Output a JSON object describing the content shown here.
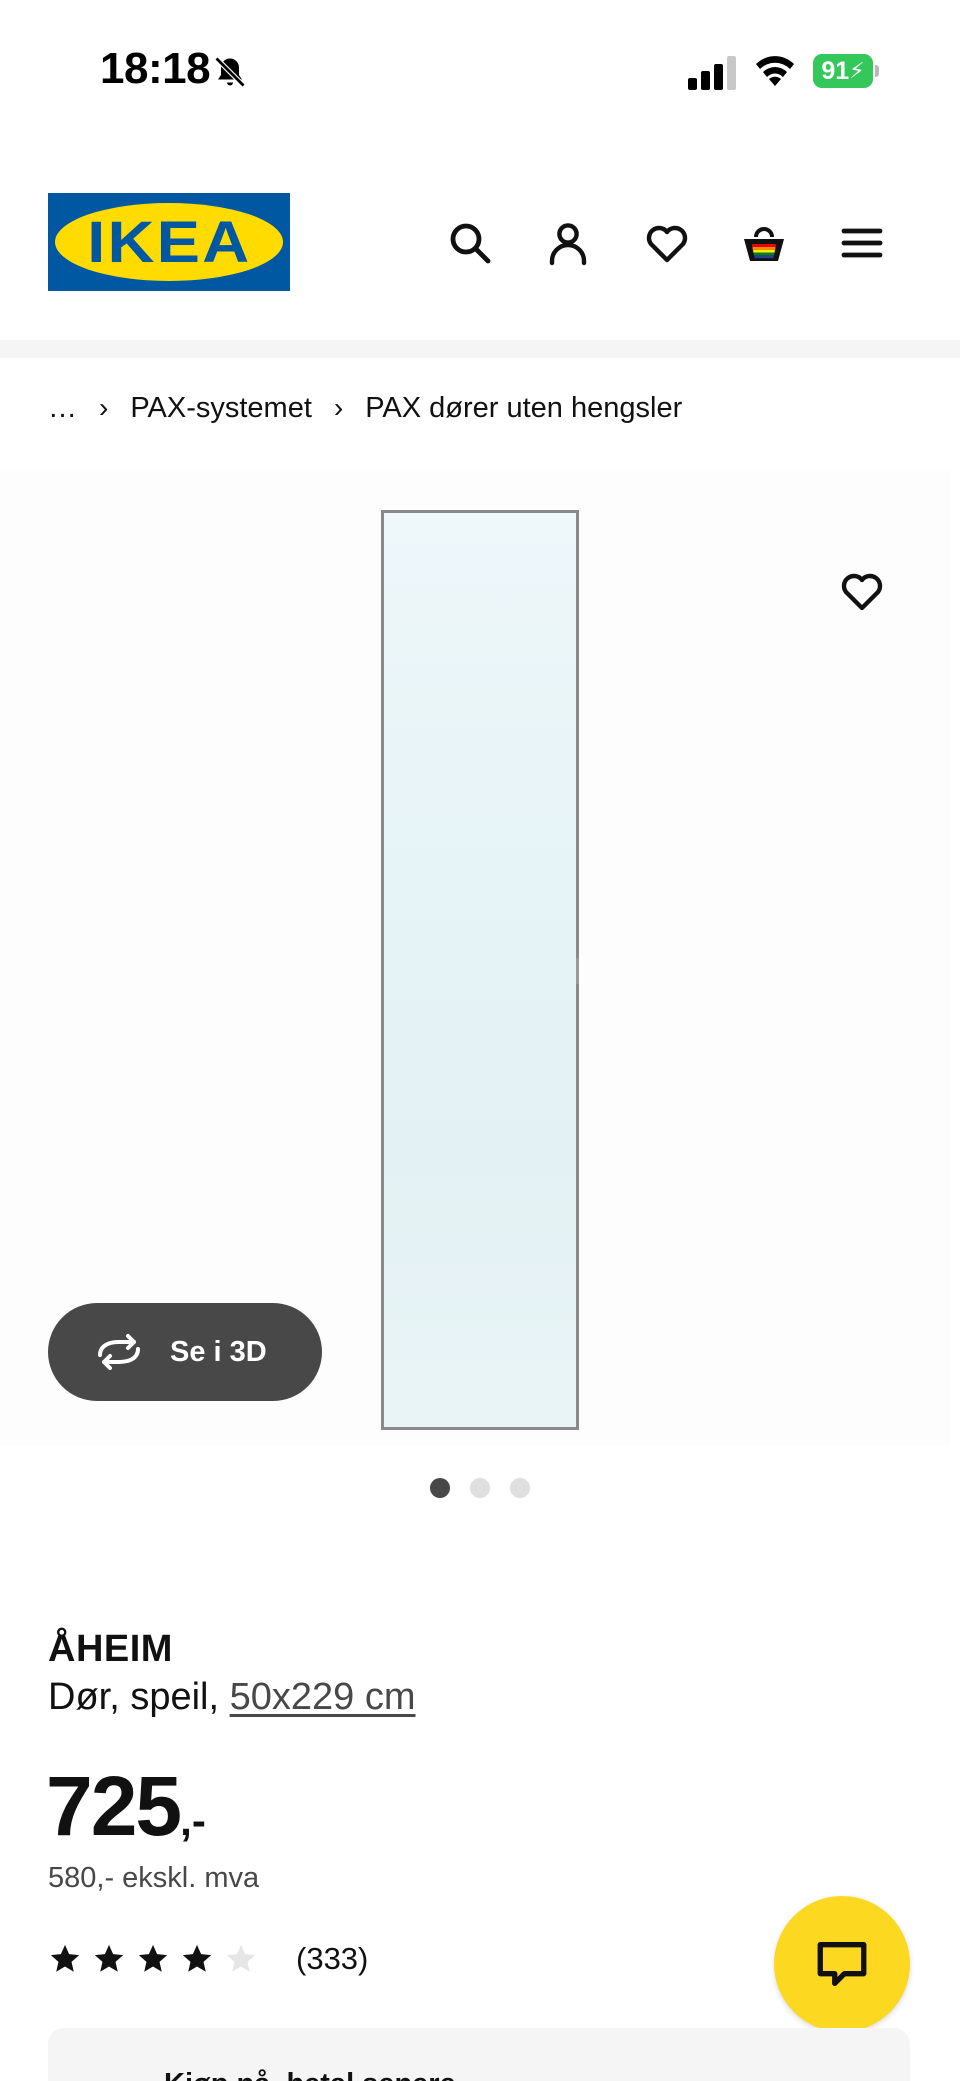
{
  "status_bar": {
    "time": "18:18",
    "battery": "91"
  },
  "header": {
    "logo_text": "IKEA"
  },
  "breadcrumb": {
    "ellipsis": "…",
    "items": [
      "PAX-systemet",
      "PAX dører uten hengsler"
    ]
  },
  "gallery": {
    "view_3d_label": "Se i 3D",
    "image_count": 3,
    "active_image": 1
  },
  "product": {
    "name": "ÅHEIM",
    "description": "Dør, speil, ",
    "size": "50x229 cm",
    "price": "725",
    "price_suffix": ",-",
    "price_ex_vat": "580,- ekskl. mva",
    "rating": 4,
    "rating_max": 5,
    "review_count": "(333)"
  },
  "bottom_card": {
    "label": "Kjøp nå, hetal senere"
  },
  "colors": {
    "ikea_blue": "#0058a3",
    "ikea_yellow": "#ffdb00",
    "chat_yellow": "#fcd821",
    "dark_button": "#484848",
    "battery_green": "#34c759"
  }
}
